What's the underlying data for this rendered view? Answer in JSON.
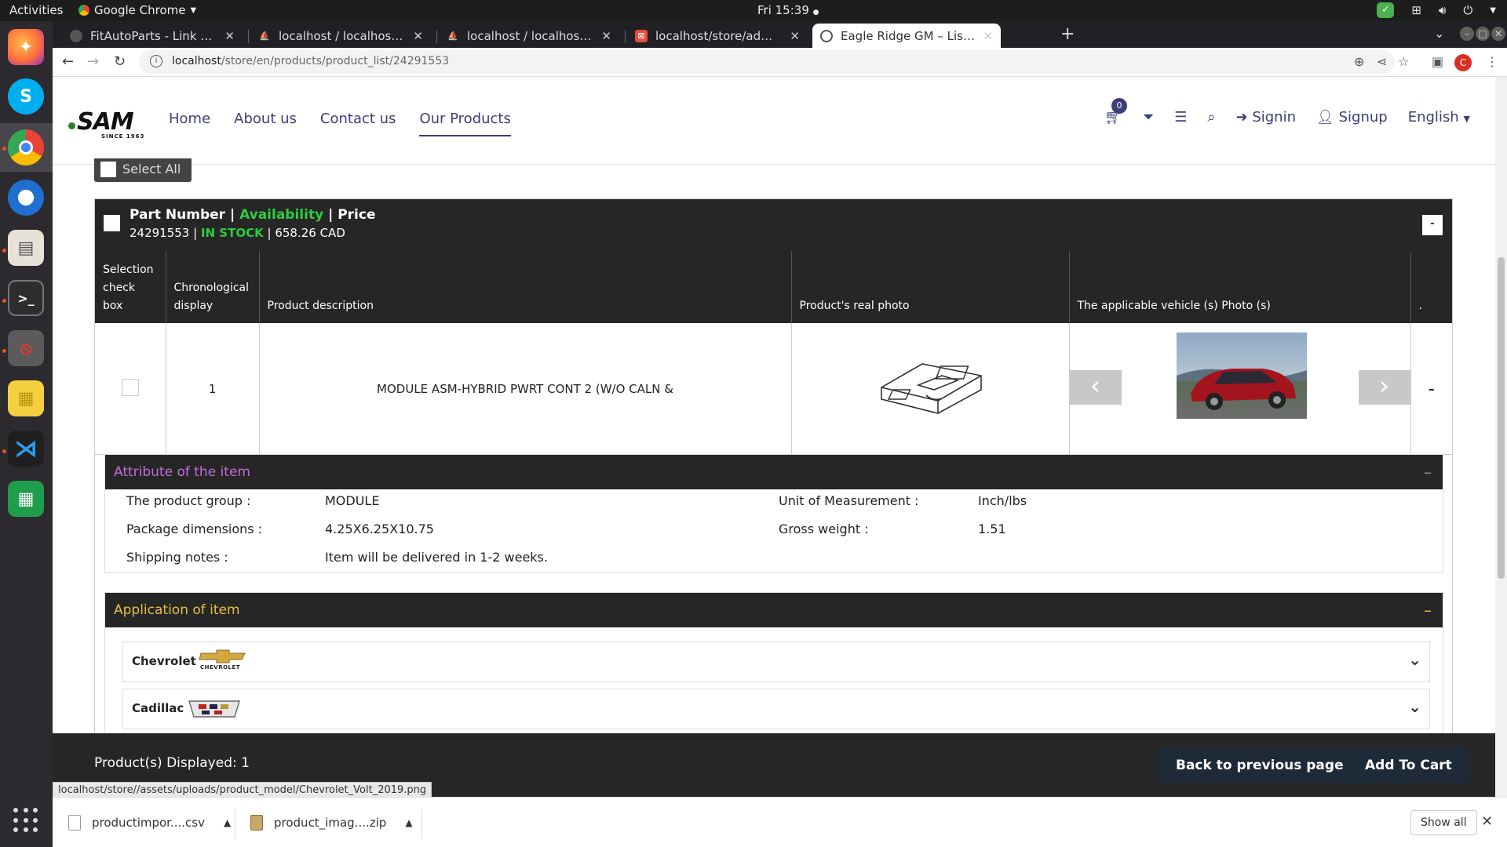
{
  "os": {
    "activities": "Activities",
    "app_menu": "Google Chrome",
    "clock": "Fri 15:39"
  },
  "browser": {
    "tabs": [
      {
        "label": "FitAutoParts - Link Uniqu",
        "active": false
      },
      {
        "label": "localhost / localhost / eag",
        "active": false
      },
      {
        "label": "localhost / localhost / eag",
        "active": false
      },
      {
        "label": "localhost/store/admin/er",
        "active": false
      },
      {
        "label": "Eagle Ridge GM – List of S",
        "active": true
      }
    ],
    "url_host": "localhost",
    "url_path": "/store/en/products/product_list/24291553",
    "profile_initial": "C"
  },
  "site": {
    "logo": "SAM",
    "logo_since": "SINCE 1963",
    "nav": [
      "Home",
      "About us",
      "Contact us",
      "Our Products"
    ],
    "cart_count": "0",
    "signin": "Signin",
    "signup": "Signup",
    "language": "English"
  },
  "select_all_label": "Select All",
  "product": {
    "head_part": "Part Number",
    "head_sep1": " | ",
    "head_availability": "Availability",
    "head_sep2": " | ",
    "head_price": "Price",
    "part_number": "24291553",
    "stock": "IN STOCK",
    "price": "658.26 CAD",
    "collapse_label": "-",
    "columns": [
      "Selection check box",
      "Chronological display",
      "Product description",
      "Product's real photo",
      "The applicable vehicle (s) Photo (s)",
      "."
    ],
    "row": {
      "index": "1",
      "description": "MODULE ASM-HYBRID PWRT CONT 2 (W/O CALN &",
      "action": "–"
    }
  },
  "attributes": {
    "title": "Attribute of the item",
    "collapse": "–",
    "product_group_label": "The product group :",
    "product_group": "MODULE",
    "uom_label": "Unit of Measurement :",
    "uom": "Inch/lbs",
    "dimensions_label": "Package dimensions :",
    "dimensions": "4.25X6.25X10.75",
    "weight_label": "Gross weight :",
    "weight": "1.51",
    "shipping_label": "Shipping notes :",
    "shipping": "Item will be delivered in 1-2 weeks."
  },
  "application": {
    "title": "Application of item",
    "collapse": "–",
    "brands": [
      "Chevrolet",
      "Cadillac"
    ],
    "chevrolet_logo_text": "CHEVROLET"
  },
  "footer": {
    "displayed": "Product(s) Displayed: 1",
    "back": "Back to previous page",
    "add_to_cart": "Add To Cart"
  },
  "status_url": "localhost/store//assets/uploads/product_model/Chevrolet_Volt_2019.png",
  "downloads": {
    "items": [
      "productimpor....csv",
      "product_imag....zip"
    ],
    "show_all": "Show all"
  },
  "colors": {
    "brand_nav": "#3a3f7a",
    "dark_bar": "#262626",
    "in_stock": "#2ecc40",
    "attr_title": "#c56bdc",
    "app_title": "#e6c03c",
    "car_red": "#a3141e"
  }
}
